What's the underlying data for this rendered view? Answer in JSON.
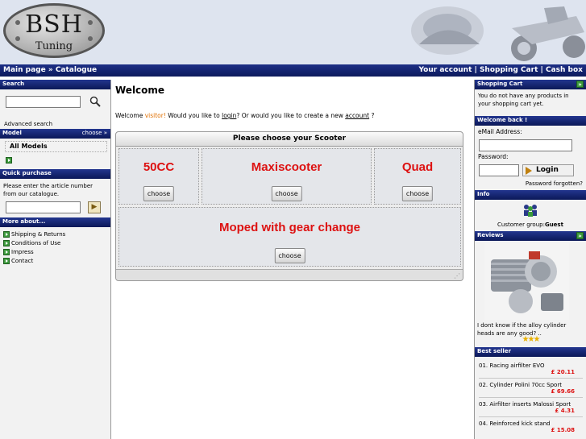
{
  "header": {
    "logo_line1": "BSH",
    "logo_line2": "Tuning"
  },
  "nav": {
    "breadcrumb_home": "Main page",
    "breadcrumb_sep": "»",
    "breadcrumb_catalogue": "Catalogue",
    "your_account": "Your account",
    "sep": "|",
    "shopping_cart": "Shopping Cart",
    "cash_box": "Cash box"
  },
  "left": {
    "search_title": "Search",
    "search_value": "",
    "advanced_search": "Advanced search",
    "model_title": "Model",
    "model_choose": "choose »",
    "all_models": "All Models",
    "quick_title": "Quick purchase",
    "quick_text": "Please enter the article number from our catalogue.",
    "quick_value": "",
    "more_title": "More about...",
    "more_items": [
      "Shipping & Returns",
      "Conditions of Use",
      "Impress",
      "Contact"
    ]
  },
  "main": {
    "title": "Welcome",
    "welcome_pre": "Welcome ",
    "visitor": "visitor!",
    "welcome_mid": " Would you like to ",
    "login_link": "login",
    "welcome_mid2": "? Or would you like to create a new ",
    "account_link": "account",
    "welcome_end": " ?",
    "scooter_title": "Please choose your Scooter",
    "categories": [
      "50CC",
      "Maxiscooter",
      "Quad",
      "Moped with gear change"
    ],
    "choose_label": "choose"
  },
  "right": {
    "cart_title": "Shopping Cart",
    "cart_empty": "You do not have any products in your shopping cart yet.",
    "welcome_back_title": "Welcome back !",
    "email_label": "eMail Address:",
    "email_value": "",
    "password_label": "Password:",
    "password_value": "",
    "login_button": "Login",
    "password_forgotten": "Password forgotten?",
    "info_title": "Info",
    "customer_group_label": "Customer group:",
    "customer_group_value": "Guest",
    "reviews_title": "Reviews",
    "review_text": "I dont know if the alloy cylinder heads are any good? ..",
    "review_stars": 3,
    "bestseller_title": "Best seller",
    "bestsellers": [
      {
        "name": "01. Racing airfilter EVO",
        "price": "£ 20.11"
      },
      {
        "name": "02. Cylinder Polini 70cc Sport",
        "price": "£ 69.66"
      },
      {
        "name": "03. Airfilter inserts Malossi Sport",
        "price": "£ 4.31"
      },
      {
        "name": "04. Reinforced kick stand",
        "price": "£ 15.08"
      }
    ]
  },
  "colors": {
    "bar_dark": "#0c1a5c",
    "price_red": "#dd1111",
    "category_red": "#dd1111",
    "visitor_orange": "#e07000",
    "arrow_green": "#3c9a3c"
  }
}
